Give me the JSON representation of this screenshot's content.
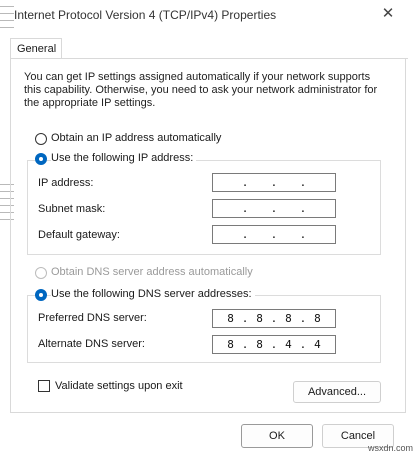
{
  "window": {
    "title": "Internet Protocol Version 4 (TCP/IPv4) Properties",
    "close_glyph": "✕"
  },
  "tabs": [
    {
      "label": "General"
    }
  ],
  "description": "You can get IP settings assigned automatically if your network supports this capability. Otherwise, you need to ask your network administrator for the appropriate IP settings.",
  "ip_section": {
    "auto_label": "Obtain an IP address automatically",
    "manual_label": "Use the following IP address:",
    "selected": "manual",
    "fields": [
      {
        "label": "IP address:",
        "octets": [
          "",
          "",
          "",
          ""
        ]
      },
      {
        "label": "Subnet mask:",
        "octets": [
          "",
          "",
          "",
          ""
        ]
      },
      {
        "label": "Default gateway:",
        "octets": [
          "",
          "",
          "",
          ""
        ]
      }
    ]
  },
  "dns_section": {
    "auto_label": "Obtain DNS server address automatically",
    "manual_label": "Use the following DNS server addresses:",
    "selected": "manual",
    "fields": [
      {
        "label": "Preferred DNS server:",
        "octets": [
          "8",
          "8",
          "8",
          "8"
        ]
      },
      {
        "label": "Alternate DNS server:",
        "octets": [
          "8",
          "8",
          "4",
          "4"
        ]
      }
    ]
  },
  "validate": {
    "label": "Validate settings upon exit",
    "checked": false
  },
  "buttons": {
    "advanced": "Advanced...",
    "ok": "OK",
    "cancel": "Cancel"
  },
  "watermark": "wsxdn.com",
  "colors": {
    "accent": "#0067c0",
    "border": "#d9d9d9",
    "disabled_text": "#9a9a9a"
  }
}
